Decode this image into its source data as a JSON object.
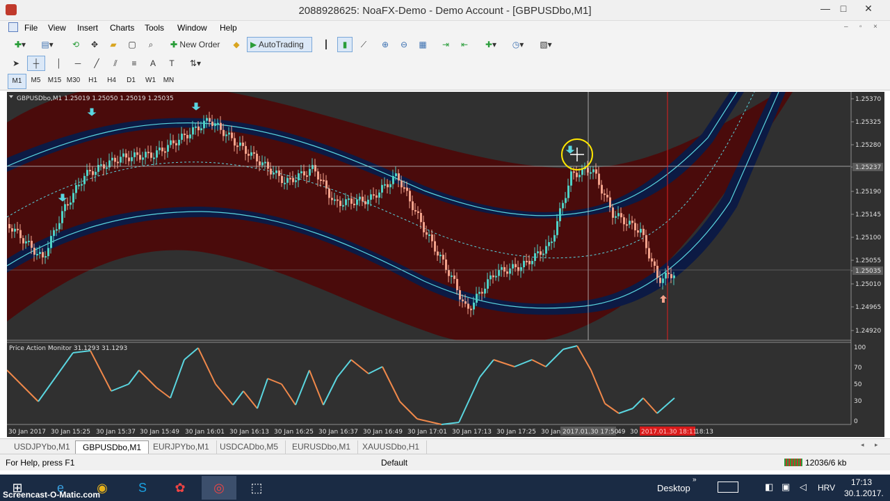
{
  "window": {
    "title": "2088928625: NoaFX-Demo - Demo Account - [GBPUSDbo,M1]",
    "minimize": "—",
    "maximize": "□",
    "close": "✕"
  },
  "menu": [
    "File",
    "View",
    "Insert",
    "Charts",
    "Tools",
    "Window",
    "Help"
  ],
  "toolbar": {
    "new_order": "New Order",
    "autotrading": "AutoTrading"
  },
  "timeframes": [
    "M1",
    "M5",
    "M15",
    "M30",
    "H1",
    "H4",
    "D1",
    "W1",
    "MN"
  ],
  "timeframe_selected": "M1",
  "chart": {
    "header": "GBPUSDbo,M1  1.25019 1.25050 1.25019 1.25035",
    "indicator_label": "Price Action Monitor 31.1293 31.1293",
    "price_ticks": [
      "1.25370",
      "1.25325",
      "1.25280",
      "1.25237",
      "1.25190",
      "1.25145",
      "1.25100",
      "1.25055",
      "1.25035",
      "1.25010",
      "1.24965",
      "1.24920"
    ],
    "price_highlight_1": "1.25237",
    "price_highlight_2": "1.25035",
    "osc_ticks": [
      "100",
      "70",
      "50",
      "30",
      "0"
    ],
    "time_ticks": [
      "30 Jan 2017",
      "30 Jan 15:25",
      "30 Jan 15:37",
      "30 Jan 15:49",
      "30 Jan 16:01",
      "30 Jan 16:13",
      "30 Jan 16:25",
      "30 Jan 16:37",
      "30 Jan 16:49",
      "30 Jan 17:01",
      "30 Jan 17:13",
      "30 Jan 17:25",
      "30 Jan"
    ],
    "time_cursor_label": "2017.01.30 17:50",
    "time_partial_1": "49",
    "time_partial_2": "30",
    "time_red_label": "2017.01.30 18:11",
    "time_last": "18:13",
    "colors": {
      "bg": "#303030",
      "band_red": "#4a0b0b",
      "band_blue": "#0c1a44",
      "line_cyan": "#5ad6e0",
      "bull": "#4fd1c5",
      "bear": "#f4a38c",
      "osc_orange": "#f0884a"
    }
  },
  "chart_tabs": [
    "USDJPYbo,M1",
    "GBPUSDbo,M1",
    "EURJPYbo,M1",
    "USDCADbo,M5",
    "EURUSDbo,M1",
    "XAUUSDbo,H1"
  ],
  "active_tab": "GBPUSDbo,M1",
  "status": {
    "help": "For Help, press F1",
    "profile": "Default",
    "memory": "12036/6 kb"
  },
  "taskbar": {
    "watermark": "Screencast-O-Matic.com",
    "desktop": "Desktop",
    "lang": "HRV",
    "time": "17:13",
    "date": "30.1.2017."
  }
}
